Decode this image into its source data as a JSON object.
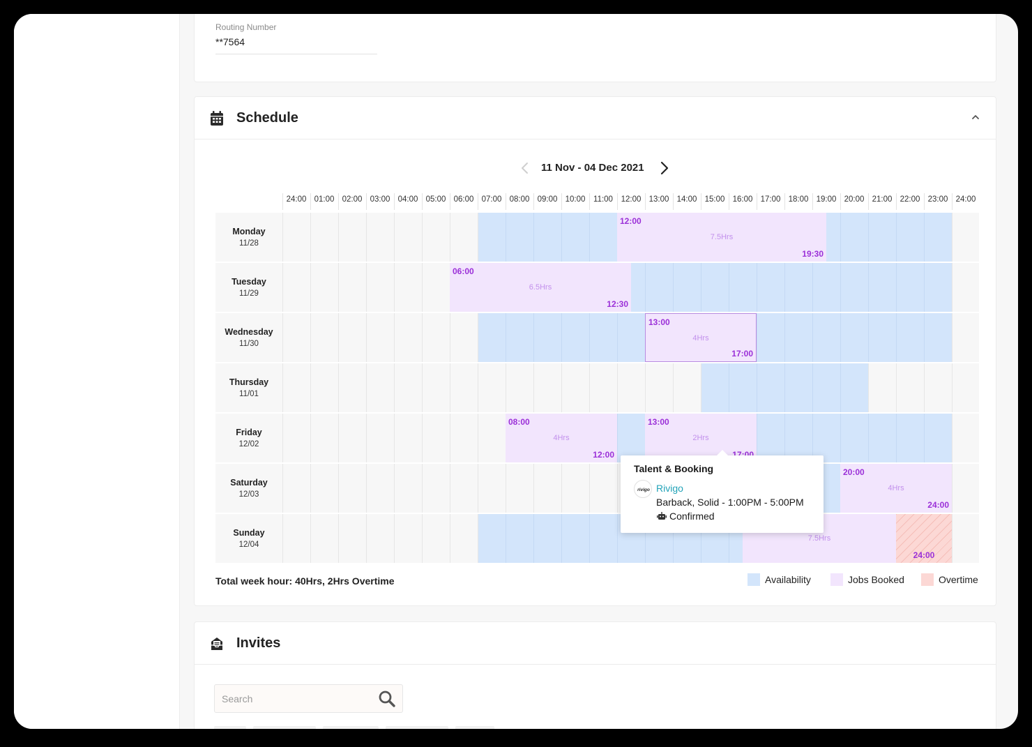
{
  "bank": {
    "routing_label": "Routing Number",
    "routing_value": "**7564"
  },
  "schedule": {
    "title": "Schedule",
    "icon": "calendar-icon",
    "date_range": "11 Nov - 04 Dec 2021",
    "hours": [
      "24:00",
      "01:00",
      "02:00",
      "03:00",
      "04:00",
      "05:00",
      "06:00",
      "07:00",
      "08:00",
      "09:00",
      "10:00",
      "11:00",
      "12:00",
      "13:00",
      "14:00",
      "15:00",
      "16:00",
      "17:00",
      "18:00",
      "19:00",
      "20:00",
      "21:00",
      "22:00",
      "23:00",
      "24:00"
    ],
    "days": [
      {
        "name": "Monday",
        "date": "11/28",
        "availability": [
          [
            7,
            24
          ]
        ],
        "jobs": [
          {
            "start": "12:00",
            "end": "19:30",
            "hours": "7.5Hrs"
          }
        ]
      },
      {
        "name": "Tuesday",
        "date": "11/29",
        "availability": [
          [
            6,
            24
          ]
        ],
        "jobs": [
          {
            "start": "06:00",
            "end": "12:30",
            "hours": "6.5Hrs"
          }
        ]
      },
      {
        "name": "Wednesday",
        "date": "11/30",
        "availability": [
          [
            7,
            24
          ]
        ],
        "jobs": [
          {
            "start": "13:00",
            "end": "17:00",
            "hours": "4Hrs",
            "selected": true
          }
        ]
      },
      {
        "name": "Thursday",
        "date": "11/01",
        "availability": [
          [
            15,
            21
          ]
        ],
        "jobs": []
      },
      {
        "name": "Friday",
        "date": "12/02",
        "availability": [
          [
            8,
            24
          ]
        ],
        "jobs": [
          {
            "start": "08:00",
            "end": "12:00",
            "hours": "4Hrs"
          },
          {
            "start": "13:00",
            "end": "17:00",
            "hours": "2Hrs"
          }
        ]
      },
      {
        "name": "Saturday",
        "date": "12/03",
        "availability": [
          [
            15,
            24
          ]
        ],
        "jobs": [
          {
            "start": "20:00",
            "end": "24:00",
            "hours": "4Hrs"
          }
        ]
      },
      {
        "name": "Sunday",
        "date": "12/04",
        "availability": [
          [
            7,
            24
          ]
        ],
        "jobs": [
          {
            "start": "16:30",
            "end": "22:00",
            "hours": "7.5Hrs"
          }
        ],
        "overtime": [
          {
            "start": "22:00",
            "end": "24:00",
            "label": "24:00"
          }
        ]
      }
    ],
    "tooltip": {
      "title": "Talent & Booking",
      "logo_text": "rivigo",
      "company": "Rivigo",
      "role": "Barback, Solid - 1:00PM - 5:00PM",
      "status": "Confirmed",
      "status_icon": "robot-icon"
    },
    "total_hours": "Total week hour: 40Hrs, 2Hrs Overtime",
    "legend": [
      {
        "label": "Availability",
        "color": "#d3e5fb"
      },
      {
        "label": "Jobs Booked",
        "color": "#f2e5fd"
      },
      {
        "label": "Overtime",
        "color": "#fcd8d5"
      }
    ],
    "colors": {
      "availability": "#d3e5fb",
      "job": "#f2e5fd",
      "job_text": "#9b30d8",
      "overtime": "#fcd8d5",
      "link": "#22a3b8"
    }
  },
  "invites": {
    "title": "Invites",
    "icon": "inbox-icon",
    "search_placeholder": "Search"
  }
}
